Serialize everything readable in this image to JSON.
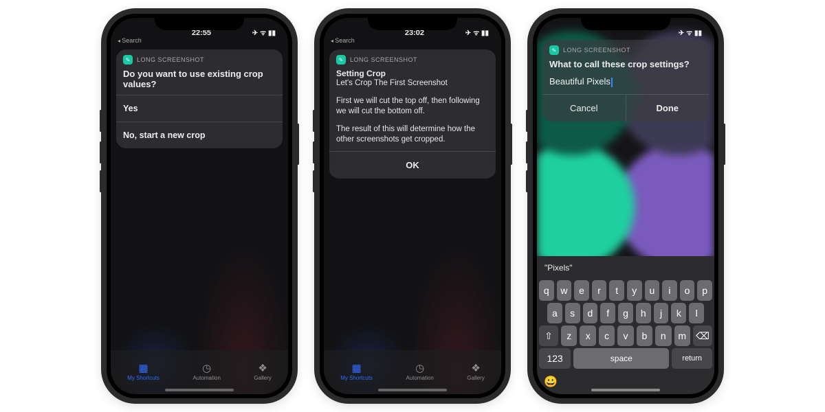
{
  "app": {
    "name": "LONG SCREENSHOT"
  },
  "breadcrumb": "Search",
  "phone1": {
    "time": "22:55",
    "prompt": "Do you want to use existing crop values?",
    "opt_yes": "Yes",
    "opt_no": "No, start a new crop"
  },
  "phone2": {
    "time": "23:02",
    "heading": "Setting Crop",
    "sub": "Let's Crop The First Screenshot",
    "body1": "First we will cut the top off, then following we will cut the bottom off.",
    "body2": "The result of this will determine how the other screenshots get cropped.",
    "ok": "OK"
  },
  "phone3": {
    "prompt": "What to call these crop settings?",
    "input": "Beautiful Pixels",
    "cancel": "Cancel",
    "done": "Done",
    "suggest": "\"Pixels\""
  },
  "tabs": {
    "my": "My Shortcuts",
    "auto": "Automation",
    "gallery": "Gallery"
  },
  "keys": {
    "row1": [
      "q",
      "w",
      "e",
      "r",
      "t",
      "y",
      "u",
      "i",
      "o",
      "p"
    ],
    "row2": [
      "a",
      "s",
      "d",
      "f",
      "g",
      "h",
      "j",
      "k",
      "l"
    ],
    "row3": [
      "z",
      "x",
      "c",
      "v",
      "b",
      "n",
      "m"
    ],
    "num": "123",
    "space": "space",
    "return": "return"
  },
  "status_icons": "✈ ᯤ ▮▮"
}
